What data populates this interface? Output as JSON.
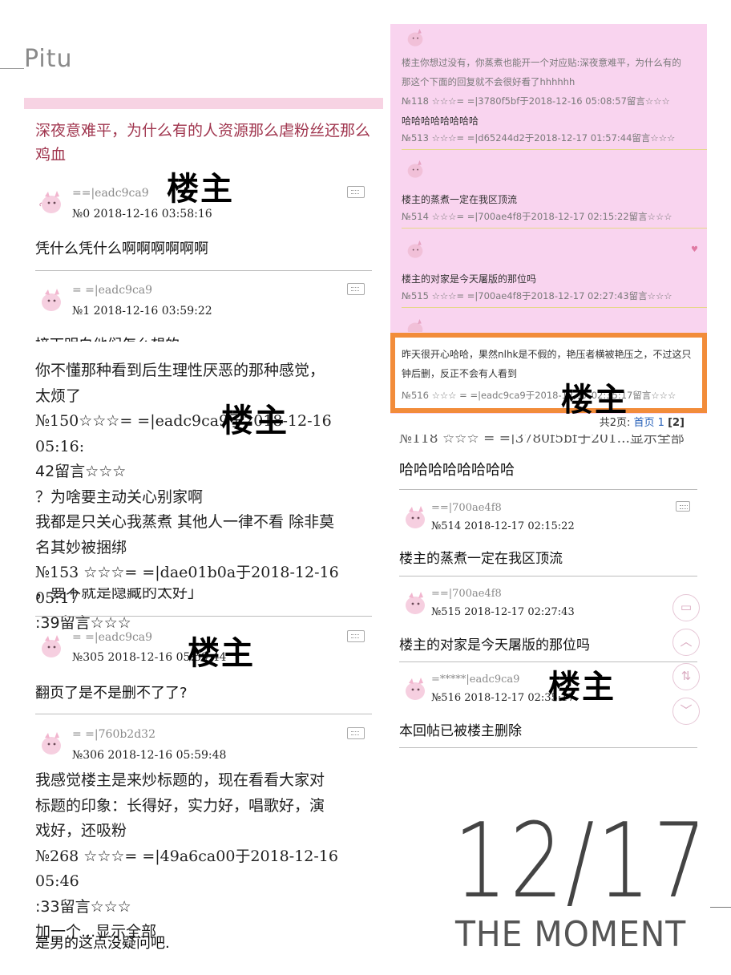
{
  "brand": "Pitu",
  "thread_title": "深夜意难平，为什么有的人资源那么虐粉丝还那么鸡血",
  "louzhu_label": "楼主",
  "left_posts": [
    {
      "user": "==|eadc9ca9",
      "meta": "№0    2018-12-16 03:58:16",
      "body": "凭什么凭什么啊啊啊啊啊啊"
    },
    {
      "user": "= =|eadc9ca9",
      "meta": "№1    2018-12-16 03:59:22",
      "body": "接下明白他们怎么想的"
    },
    {
      "user": "= =|eadc9ca9",
      "meta": "№305    2018-12-16 05:59:44",
      "body": "翻页了是不是删不了了?"
    },
    {
      "user": "= =|760b2d32",
      "meta": "№306    2018-12-16 05:59:48",
      "body": ""
    }
  ],
  "left_long_text_1": [
    "你不懂那种看到后生理性厌恶的那种感觉，",
    "太烦了",
    "№150☆☆☆= =|eadc9ca9于2018-12-16 05:16:",
    "42留言☆☆☆",
    "？为啥要主动关心别家啊",
    "我都是只关心我蒸煮 其他人一律不看 除非莫",
    "名其妙被捆绑",
    "№153 ☆☆☆= =|dae01b0a于2018-12-16 05:17",
    ":39留言☆☆☆",
    "，要不就是隐藏的太好」"
  ],
  "left_long_text_2": [
    "我感觉楼主是来炒标题的，现在看看大家对",
    "标题的印象：长得好，实力好，唱歌好，演",
    "戏好，还吸粉",
    "№268 ☆☆☆= =|49a6ca00于2018-12-16 05:46",
    ":33留言☆☆☆",
    "加一个...显示全部"
  ],
  "left_last_line": "是男的这点没疑问吧.",
  "shot": {
    "q1": "楼主你想过没有，你蒸煮也能开一个对应贴:深夜意难平，为什么有的",
    "q2": "那这个下面的回复就不会很好看了hhhhhh",
    "q3": "№118 ☆☆☆= =|3780f5bf于2018-12-16 05:08:57留言☆☆☆",
    "r1": "哈哈哈哈哈哈哈哈",
    "r1meta": "№513 ☆☆☆= =|d65244d2于2018-12-17 01:57:44留言☆☆☆",
    "r2": "楼主的蒸煮一定在我区顶流",
    "r2meta": "№514 ☆☆☆= =|700ae4f8于2018-12-17 02:15:22留言☆☆☆",
    "r3": "楼主的对家是今天屠版的那位吗",
    "r3meta": "№515 ☆☆☆= =|700ae4f8于2018-12-17 02:27:43留言☆☆☆",
    "o1": "昨天很开心哈哈，果然nlhk是不假的，艳压者横被艳压之，不过这只",
    "o2": "钟后删，反正不会有人看到",
    "o3": "№516 ☆☆☆ = =|eadc9ca9于2018-12-17 02:35:17留言☆☆☆",
    "pager_prefix": "共2页:",
    "pager_first": "首页 1",
    "pager_page": "[2]"
  },
  "right_cut_line": "№118 ☆☆☆ = =|3780f5bf于201...显示全部",
  "right_first_body": "哈哈哈哈哈哈哈哈",
  "right_posts": [
    {
      "user": "==|700ae4f8",
      "meta": "№514    2018-12-17 02:15:22",
      "body": "楼主的蒸煮一定在我区顶流"
    },
    {
      "user": "==|700ae4f8",
      "meta": "№515    2018-12-17 02:27:43",
      "body": "楼主的对家是今天屠版的那位吗"
    },
    {
      "user": "=*****|eadc9ca9",
      "meta": "№516    2018-12-17 02:35:17",
      "body": "本回帖已被楼主删除"
    }
  ],
  "date_big": "12/17",
  "moment": "THE MOMENT",
  "colors": {
    "title": "#a0354e",
    "pink": "#f9d4ef",
    "orange": "#f28c3a",
    "link": "#2660b8"
  }
}
